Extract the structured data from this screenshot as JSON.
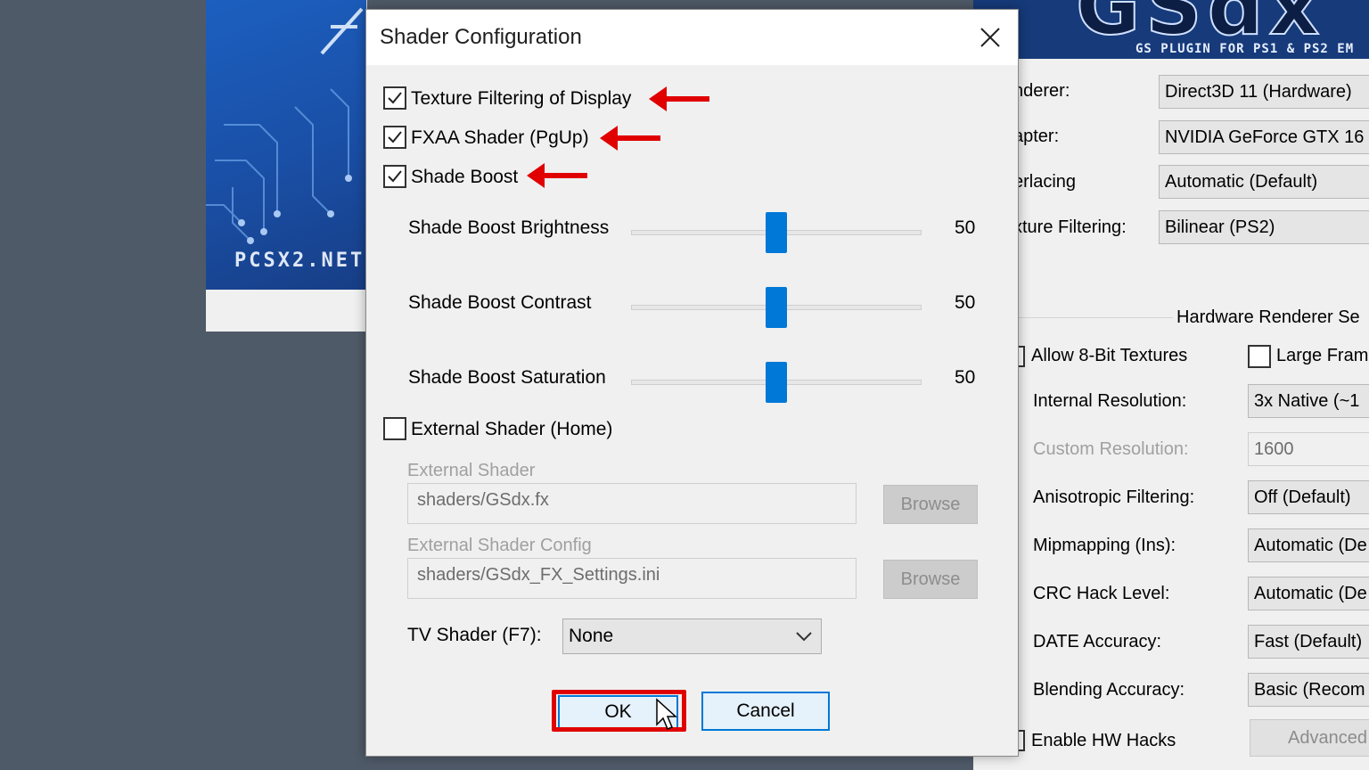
{
  "pcsx2": {
    "banner_text": "PCSX2.NET"
  },
  "gsdx": {
    "logo": "GSdx",
    "subtitle": "GS PLUGIN FOR PS1 & PS2 EM",
    "rows": [
      {
        "label": "nderer:",
        "value": "Direct3D 11 (Hardware)"
      },
      {
        "label": "apter:",
        "value": "NVIDIA GeForce GTX 16"
      },
      {
        "label": "erlacing",
        "value": "Automatic (Default)"
      },
      {
        "label": "xture Filtering:",
        "value": "Bilinear (PS2)"
      }
    ],
    "group_title": "Hardware Renderer Se",
    "allow_8bit": "Allow 8-Bit Textures",
    "large_frame": "Large Fram",
    "hw_rows": [
      {
        "label": "Internal Resolution:",
        "value": "3x Native (~1"
      },
      {
        "label": "Custom Resolution:",
        "value": "1600"
      },
      {
        "label": "Anisotropic Filtering:",
        "value": "Off (Default)"
      },
      {
        "label": "Mipmapping (Ins):",
        "value": "Automatic (De"
      },
      {
        "label": "CRC Hack Level:",
        "value": "Automatic (De"
      },
      {
        "label": "DATE Accuracy:",
        "value": "Fast (Default)"
      },
      {
        "label": "Blending Accuracy:",
        "value": "Basic (Recom"
      }
    ],
    "enable_hw_hacks": "Enable HW Hacks",
    "advanced_button": "Advanced"
  },
  "dialog": {
    "title": "Shader Configuration",
    "checkboxes": [
      {
        "label": "Texture Filtering of Display",
        "checked": true
      },
      {
        "label": "FXAA Shader (PgUp)",
        "checked": true
      },
      {
        "label": "Shade Boost",
        "checked": true
      },
      {
        "label": "External Shader (Home)",
        "checked": false
      }
    ],
    "sliders": [
      {
        "label": "Shade Boost Brightness",
        "value": "50",
        "level": 0.5
      },
      {
        "label": "Shade Boost Contrast",
        "value": "50",
        "level": 0.5
      },
      {
        "label": "Shade Boost Saturation",
        "value": "50",
        "level": 0.5
      }
    ],
    "external_shader": {
      "label": "External Shader",
      "value": "shaders/GSdx.fx",
      "browse": "Browse"
    },
    "external_shader_config": {
      "label": "External Shader Config",
      "value": "shaders/GSdx_FX_Settings.ini",
      "browse": "Browse"
    },
    "tv_shader": {
      "label": "TV Shader (F7):",
      "value": "None"
    },
    "ok": "OK",
    "cancel": "Cancel"
  },
  "colors": {
    "accent": "#0078d7",
    "annotation": "#e00000"
  }
}
